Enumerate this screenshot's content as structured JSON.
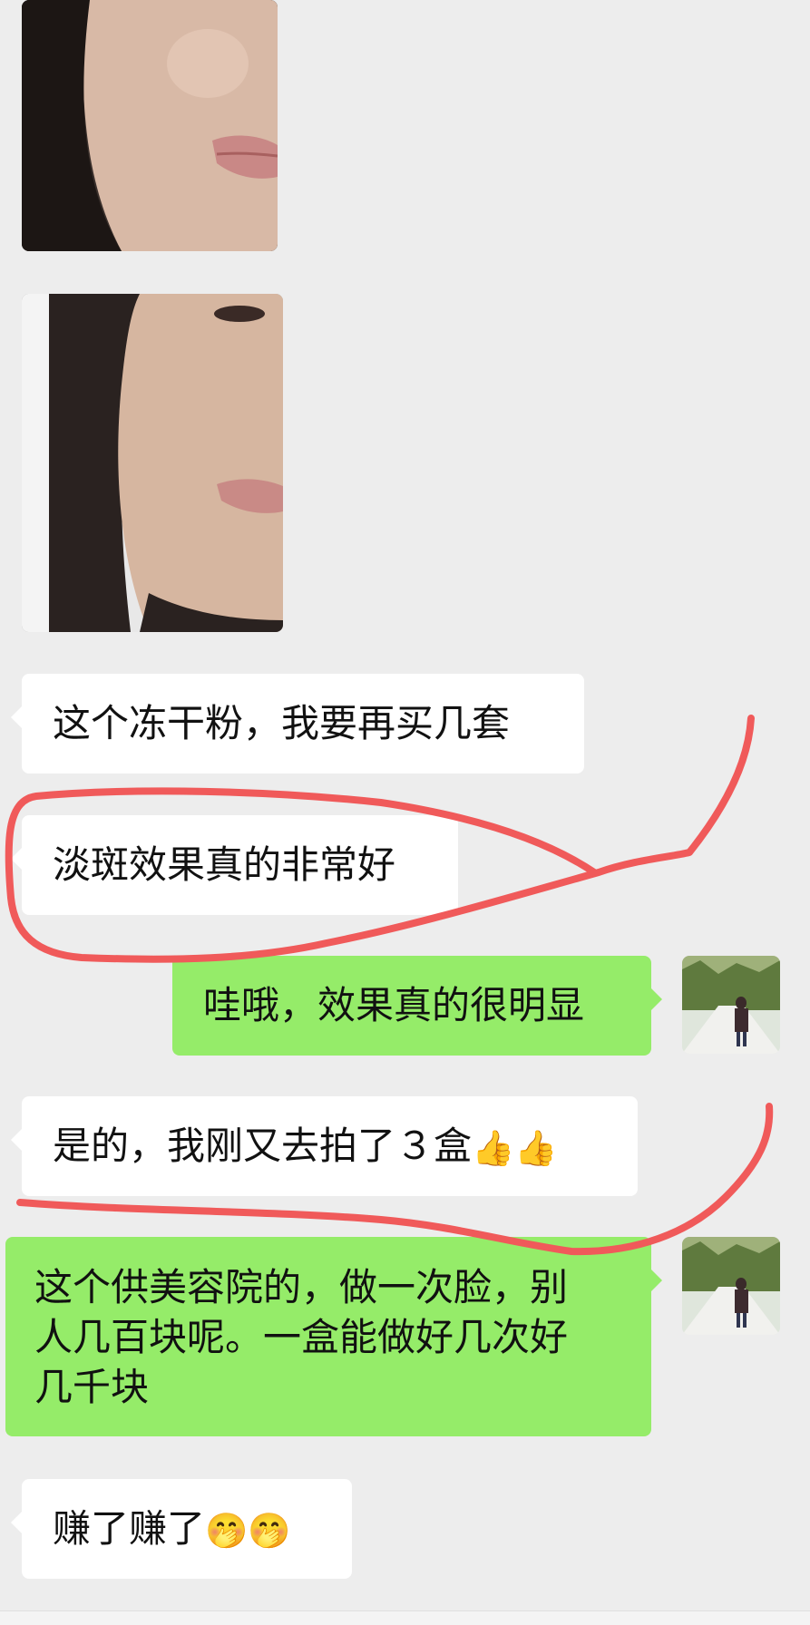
{
  "messages": [
    {
      "side": "in",
      "type": "image",
      "content": "selfie photo"
    },
    {
      "side": "in",
      "type": "image",
      "content": "selfie photo"
    },
    {
      "side": "in",
      "type": "text",
      "text": "这个冻干粉，我要再买几套"
    },
    {
      "side": "in",
      "type": "text",
      "text": "淡斑效果真的非常好"
    },
    {
      "side": "out",
      "type": "text",
      "text": "哇哦，效果真的很明显"
    },
    {
      "side": "in",
      "type": "text",
      "text": "是的，我刚又去拍了３盒",
      "emoji": [
        "thumbs-up-icon",
        "thumbs-up-icon"
      ]
    },
    {
      "side": "out",
      "type": "text",
      "lines": [
        "这个供美容院的，做一次脸，别",
        "人几百块呢。一盒能做好几次好",
        "几千块"
      ]
    },
    {
      "side": "in",
      "type": "text",
      "text": "赚了赚了",
      "emoji": [
        "thinking-face-icon",
        "thinking-face-icon"
      ]
    }
  ],
  "emoji_glyphs": {
    "thumbs_up": "👍",
    "thinking": "🤭"
  },
  "annotation_color": "#f05a5a",
  "outgoing_bubble_color": "#95ec69",
  "background_color": "#ededed"
}
